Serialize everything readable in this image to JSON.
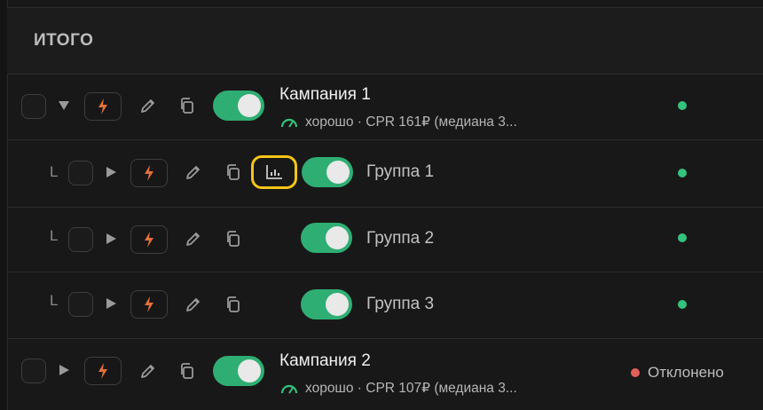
{
  "total_label": "ИТОГО",
  "rows": [
    {
      "kind": "campaign",
      "name": "Кампания 1",
      "subtitle": "хорошо · CPR 161₽ (медиана 3...",
      "status_text": ""
    },
    {
      "kind": "group",
      "indent": "L",
      "name": "Группа 1"
    },
    {
      "kind": "group",
      "indent": "L",
      "name": "Группа 2"
    },
    {
      "kind": "group",
      "indent": "L",
      "name": "Группа 3"
    },
    {
      "kind": "campaign",
      "name": "Кампания 2",
      "subtitle": "хорошо · CPR 107₽ (медиана 3...",
      "status_text": "Отклонено"
    }
  ],
  "colors": {
    "toggle_on": "#2fae73",
    "bolt": "#e2703a",
    "status_ok": "#34c27c",
    "status_rejected": "#e0605a",
    "highlight": "#f5c518",
    "gauge": "#34c27c"
  },
  "icons": {
    "expand": "triangle-icon",
    "bolt": "bolt-icon",
    "edit": "pencil-icon",
    "copy": "copy-icon",
    "stats": "bar-chart-icon",
    "perf": "gauge-icon"
  }
}
